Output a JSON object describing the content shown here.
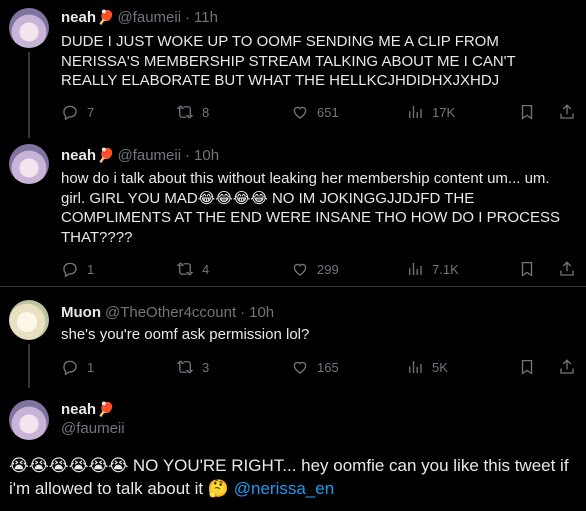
{
  "tweets": [
    {
      "name": "neah",
      "badge": "🏓",
      "handle": "@faumeii",
      "time": "11h",
      "text": "DUDE I JUST WOKE UP TO OOMF SENDING ME A CLIP FROM NERISSA'S MEMBERSHIP STREAM TALKING ABOUT ME I CAN'T REALLY ELABORATE BUT WHAT THE HELLKCJHDIDHXJXHDJ",
      "replies": "7",
      "retweets": "8",
      "likes": "651",
      "views": "17K"
    },
    {
      "name": "neah",
      "badge": "🏓",
      "handle": "@faumeii",
      "time": "10h",
      "text": "how do i talk about this without leaking her membership content um... um. girl. GIRL YOU MAD😂😂😂😂 NO IM JOKINGGJJDJFD THE COMPLIMENTS AT THE END WERE INSANE THO HOW DO I PROCESS THAT????",
      "replies": "1",
      "retweets": "4",
      "likes": "299",
      "views": "7.1K"
    },
    {
      "name": "Muon",
      "badge": "",
      "handle": "@TheOther4ccount",
      "time": "10h",
      "text": "she's you're oomf ask permission lol?",
      "replies": "1",
      "retweets": "3",
      "likes": "165",
      "views": "5K"
    }
  ],
  "main_tweet": {
    "name": "neah",
    "badge": "🏓",
    "handle": "@faumeii",
    "text": "😭😭😭😭😭😭 NO YOU'RE RIGHT...  hey oomfie can you like this tweet if i'm allowed to talk about it 🤔 ",
    "mention": "@nerissa_en"
  },
  "separator": "·",
  "icons": [
    "reply-icon",
    "retweet-icon",
    "like-icon",
    "views-icon",
    "bookmark-icon",
    "share-icon"
  ]
}
